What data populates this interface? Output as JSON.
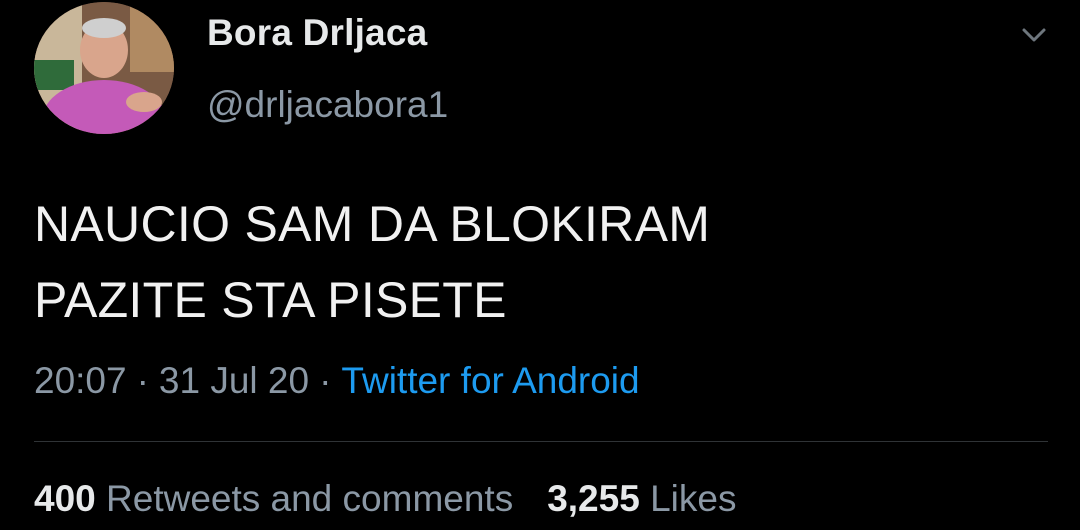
{
  "user": {
    "display_name": "Bora Drljaca",
    "handle": "@drljacabora1"
  },
  "icons": {
    "avatar": "profile-photo",
    "menu": "chevron-down-icon"
  },
  "tweet": {
    "line1": "NAUCIO SAM DA BLOKIRAM",
    "line2": "PAZITE STA PISETE"
  },
  "meta": {
    "time": "20:07",
    "separator": "·",
    "date": "31 Jul 20",
    "source": "Twitter for Android"
  },
  "stats": {
    "retweets_count": "400",
    "retweets_label": "Retweets and comments",
    "likes_count": "3,255",
    "likes_label": "Likes"
  },
  "colors": {
    "background": "#000000",
    "text": "#e7e9ea",
    "secondary": "#8b98a5",
    "link": "#1d9bf0",
    "divider": "#2f3336"
  }
}
